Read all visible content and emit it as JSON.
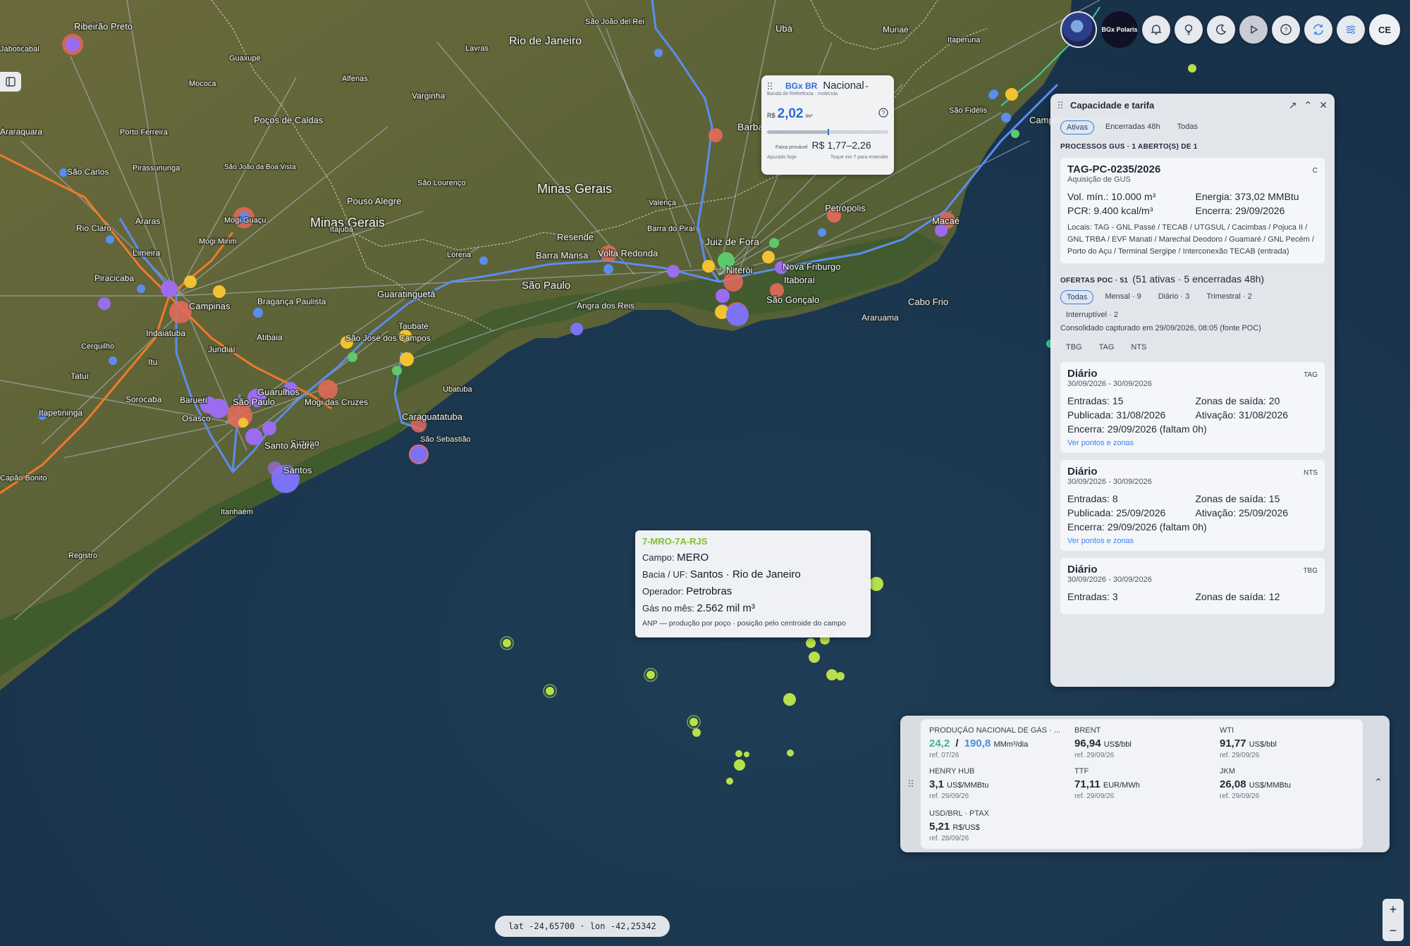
{
  "map": {
    "land_labels": [
      {
        "text": "Ribeirão Preto",
        "size": 13
      },
      {
        "text": "Minas Gerais",
        "size": 18
      },
      {
        "text": "Minas Gerais",
        "size": 18
      },
      {
        "text": "São Paulo",
        "size": 15
      },
      {
        "text": "Rio de Janeiro",
        "size": 16
      },
      {
        "text": "Barbacena",
        "size": 14
      },
      {
        "text": "Juiz de Fora",
        "size": 14
      },
      {
        "text": "Petrópolis",
        "size": 13
      },
      {
        "text": "Nova Friburgo",
        "size": 13
      },
      {
        "text": "Volta Redonda",
        "size": 13
      },
      {
        "text": "Barra Mansa",
        "size": 13
      },
      {
        "text": "Resende",
        "size": 13
      },
      {
        "text": "Angra dos Reis",
        "size": 12
      },
      {
        "text": "Niterói",
        "size": 13
      },
      {
        "text": "São Gonçalo",
        "size": 13
      },
      {
        "text": "Itaboraí",
        "size": 13
      },
      {
        "text": "Cabo Frio",
        "size": 13
      },
      {
        "text": "Araruama",
        "size": 12
      },
      {
        "text": "Macaé",
        "size": 13
      },
      {
        "text": "Campos dos Goytacazes",
        "size": 13
      },
      {
        "text": "São Fidélis",
        "size": 11
      },
      {
        "text": "Itaperuna",
        "size": 11
      },
      {
        "text": "Muriaé",
        "size": 12
      },
      {
        "text": "Ubá",
        "size": 13
      },
      {
        "text": "Lavras",
        "size": 11
      },
      {
        "text": "Varginha",
        "size": 12
      },
      {
        "text": "Alfenas",
        "size": 11
      },
      {
        "text": "Guaxupé",
        "size": 11
      },
      {
        "text": "Poços de Caldas",
        "size": 13
      },
      {
        "text": "Pouso Alegre",
        "size": 13
      },
      {
        "text": "Mococa",
        "size": 11
      },
      {
        "text": "Araraquara",
        "size": 12
      },
      {
        "text": "São Carlos",
        "size": 12
      },
      {
        "text": "Rio Claro",
        "size": 12
      },
      {
        "text": "Araras",
        "size": 12
      },
      {
        "text": "Limeira",
        "size": 12
      },
      {
        "text": "Piracicaba",
        "size": 12
      },
      {
        "text": "Campinas",
        "size": 13
      },
      {
        "text": "Indaiatuba",
        "size": 12
      },
      {
        "text": "Jundiaí",
        "size": 12
      },
      {
        "text": "Bragança Paulista",
        "size": 12
      },
      {
        "text": "Atibaia",
        "size": 12
      },
      {
        "text": "Sorocaba",
        "size": 12
      },
      {
        "text": "Itu",
        "size": 12
      },
      {
        "text": "Tatuí",
        "size": 12
      },
      {
        "text": "Itapetininga",
        "size": 12
      },
      {
        "text": "Barueri",
        "size": 12
      },
      {
        "text": "Osasco",
        "size": 12
      },
      {
        "text": "São Paulo",
        "size": 13
      },
      {
        "text": "Guarulhos",
        "size": 13
      },
      {
        "text": "Mogi das Cruzes",
        "size": 12
      },
      {
        "text": "Suzano",
        "size": 12
      },
      {
        "text": "Santo André",
        "size": 13
      },
      {
        "text": "Santos",
        "size": 13
      },
      {
        "text": "Itanhaém",
        "size": 11
      },
      {
        "text": "Registro",
        "size": 11
      },
      {
        "text": "Capão Bonito",
        "size": 11
      },
      {
        "text": "Taubaté",
        "size": 12
      },
      {
        "text": "Guaratinguetá",
        "size": 13
      },
      {
        "text": "São José dos Campos",
        "size": 12
      },
      {
        "text": "Caraguatatuba",
        "size": 13
      },
      {
        "text": "São Sebastião",
        "size": 11
      },
      {
        "text": "Ubatuba",
        "size": 11
      },
      {
        "text": "Itajubá",
        "size": 11
      },
      {
        "text": "Lorena",
        "size": 11
      },
      {
        "text": "Valença",
        "size": 11
      },
      {
        "text": "Barra do Piraí",
        "size": 11
      },
      {
        "text": "São João del Rei",
        "size": 11
      },
      {
        "text": "São Lourenço",
        "size": 11
      },
      {
        "text": "Pirassununga",
        "size": 11
      },
      {
        "text": "Mogi Guaçu",
        "size": 11
      },
      {
        "text": "Mogi Mirim",
        "size": 11
      },
      {
        "text": "São João da Boa Vista",
        "size": 10
      },
      {
        "text": "Cerquilho",
        "size": 11
      },
      {
        "text": "Jaboticabal",
        "size": 11
      },
      {
        "text": "Porto Ferreira",
        "size": 11
      }
    ]
  },
  "toolbar": {
    "brand_label": "BGx Polaris",
    "user_initials": "CE"
  },
  "bgx": {
    "title": "BGx BR",
    "selected_option": "Nacional",
    "subtitle": "Banda de Referência · molécula",
    "currency": "R$",
    "price": "2,02",
    "unit": "/m³",
    "range_label": "Faixa provável",
    "range_value": "R$ 1,77–2,26",
    "foot_left": "Apurado hoje",
    "foot_right": "Toque em ? para entender",
    "range_position_fraction": 0.5
  },
  "capacity": {
    "title": "Capacidade e tarifa",
    "filter_tabs": [
      "Ativas",
      "Encerradas 48h",
      "Todas"
    ],
    "gus_section_title": "PROCESSOS GUS · 1 ABERTO(S) DE 1",
    "gus_process": {
      "code": "TAG-PC-0235/2026",
      "tag": "C",
      "subtitle": "Aquisição de GUS",
      "vol_min": "Vol. mín.: 10.000 m³",
      "energia": "Energia: 373,02 MMBtu",
      "pcr": "PCR: 9.400 kcal/m³",
      "encerra": "Encerra: 29/09/2026",
      "locais": "Locais: TAG - GNL Passé / TECAB / UTGSUL / Cacimbas / Pojuca II / GNL TRBA / EVF Manati / Marechal Deodoro / Guamaré / GNL Pecém / Porto do Açu / Terminal Sergipe / Interconexão TECAB (entrada)"
    },
    "poc_section_title": "OFERTAS POC · 51",
    "poc_section_detail": "(51 ativas · 5 encerradas 48h)",
    "poc_filters": [
      "Todas",
      "Mensal · 9",
      "Diário · 3",
      "Trimestral · 2",
      "Interruptível · 2"
    ],
    "consolidated_note": "Consolidado capturado em 29/09/2026, 08:05 (fonte POC)",
    "operators": [
      "TBG",
      "TAG",
      "NTS"
    ],
    "offers": [
      {
        "title": "Diário",
        "tag": "TAG",
        "period": "30/09/2026 - 30/09/2026",
        "entradas": "Entradas: 15",
        "zonas": "Zonas de saída: 20",
        "publicada": "Publicada: 31/08/2026",
        "ativacao": "Ativação: 31/08/2026",
        "encerra": "Encerra: 29/09/2026 (faltam 0h)",
        "link": "Ver pontos e zonas"
      },
      {
        "title": "Diário",
        "tag": "NTS",
        "period": "30/09/2026 - 30/09/2026",
        "entradas": "Entradas: 8",
        "zonas": "Zonas de saída: 15",
        "publicada": "Publicada: 25/09/2026",
        "ativacao": "Ativação: 25/09/2026",
        "encerra": "Encerra: 29/09/2026 (faltam 0h)",
        "link": "Ver pontos e zonas"
      },
      {
        "title": "Diário",
        "tag": "TBG",
        "period": "30/09/2026 - 30/09/2026",
        "entradas": "Entradas: 3",
        "zonas": "Zonas de saída: 12"
      }
    ]
  },
  "market": {
    "producao": {
      "label": "PRODUÇÃO NACIONAL DE GÁS · ...",
      "value_a": "24,2",
      "sep": "/",
      "value_b": "190,8",
      "unit": "MMm³/dia",
      "ref": "ref. 07/26",
      "color_a": "#3fb58a",
      "color_b": "#4a90e2"
    },
    "brent": {
      "label": "BRENT",
      "value": "96,94",
      "unit": "US$/bbl",
      "ref": "ref. 29/09/26"
    },
    "wti": {
      "label": "WTI",
      "value": "91,77",
      "unit": "US$/bbl",
      "ref": "ref. 29/09/26"
    },
    "henry": {
      "label": "HENRY HUB",
      "value": "3,1",
      "unit": "US$/MMBtu",
      "ref": "ref. 29/09/26"
    },
    "ttf": {
      "label": "TTF",
      "value": "71,11",
      "unit": "EUR/MWh",
      "ref": "ref. 29/09/26"
    },
    "jkm": {
      "label": "JKM",
      "value": "26,08",
      "unit": "US$/MMBtu",
      "ref": "ref. 29/09/26"
    },
    "usdbrl": {
      "label": "USD/BRL · PTAX",
      "value": "5,21",
      "unit": "R$/US$",
      "ref": "ref. 28/09/26"
    }
  },
  "tooltip": {
    "well": "7-MRO-7A-RJS",
    "campo_label": "Campo:",
    "campo": "MERO",
    "bacia_label": "Bacia / UF:",
    "bacia": "Santos · Rio de Janeiro",
    "operador_label": "Operador:",
    "operador": "Petrobras",
    "gas_label": "Gás no mês:",
    "gas": "2.562 mil m³",
    "note": "ANP — produção por poço · posição pelo centroide do campo",
    "well_color": "#7cc22e"
  },
  "coords": "lat -24,65700 · lon -42,25342",
  "zoom": {
    "in": "+",
    "out": "−"
  },
  "colors": {
    "pipeline": "#5b8def",
    "orange_pipeline": "#f07a2a",
    "offshore_well": "#b8e04a",
    "purple_node": "#9b6cf0",
    "yellow_node": "#f2c230"
  }
}
